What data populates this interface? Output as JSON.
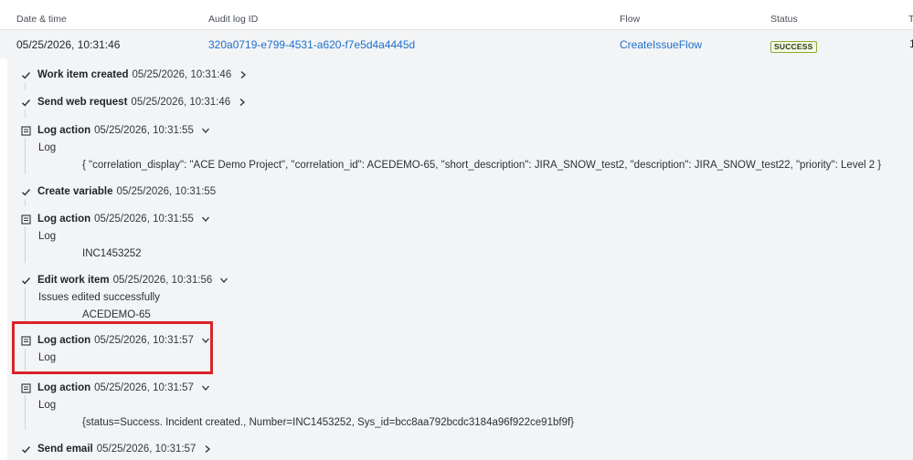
{
  "table": {
    "headers": {
      "date_time": "Date & time",
      "audit_log_id": "Audit log ID",
      "flow": "Flow",
      "status": "Status",
      "extra": "T"
    },
    "row": {
      "date_time": "05/25/2026, 10:31:46",
      "audit_log_id": "320a0719-e799-4531-a620-f7e5d4a4445d",
      "flow": "CreateIssueFlow",
      "status": "SUCCESS",
      "extra": "1"
    }
  },
  "entries": [
    {
      "title": "Work item created",
      "time": "05/25/2026, 10:31:46",
      "icon": "check-icon",
      "chevron": "chevron-right-icon"
    },
    {
      "title": "Send web request",
      "time": "05/25/2026, 10:31:46",
      "icon": "check-icon",
      "chevron": "chevron-right-icon"
    },
    {
      "title": "Log action",
      "time": "05/25/2026, 10:31:55",
      "icon": "log-icon",
      "chevron": "chevron-down-icon",
      "label": "Log",
      "value": "{ \"correlation_display\": \"ACE Demo Project\", \"correlation_id\": ACEDEMO-65, \"short_description\": JIRA_SNOW_test2, \"description\": JIRA_SNOW_test22, \"priority\": Level 2 }"
    },
    {
      "title": "Create variable",
      "time": "05/25/2026, 10:31:55",
      "icon": "check-icon",
      "chevron": ""
    },
    {
      "title": "Log action",
      "time": "05/25/2026, 10:31:55",
      "icon": "log-icon",
      "chevron": "chevron-down-icon",
      "label": "Log",
      "value": "INC1453252"
    },
    {
      "title": "Edit work item",
      "time": "05/25/2026, 10:31:56",
      "icon": "check-icon",
      "chevron": "chevron-down-icon",
      "label": "Issues edited successfully",
      "value": "ACEDEMO-65"
    },
    {
      "title": "Log action",
      "time": "05/25/2026, 10:31:57",
      "icon": "log-icon",
      "chevron": "chevron-down-icon",
      "label": "Log"
    },
    {
      "title": "Log action",
      "time": "05/25/2026, 10:31:57",
      "icon": "log-icon",
      "chevron": "chevron-down-icon",
      "label": "Log",
      "value": "{status=Success. Incident created., Number=INC1453252, Sys_id=bcc8aa792bcdc3184a96f922ce91bf9f}"
    },
    {
      "title": "Send email",
      "time": "05/25/2026, 10:31:57",
      "icon": "check-icon",
      "chevron": "chevron-right-icon"
    }
  ],
  "colors": {
    "link": "#1e6fcf",
    "panel_bg": "#f3f4f5",
    "highlight_border": "#d8242a",
    "badge_border": "#8fa83a"
  }
}
